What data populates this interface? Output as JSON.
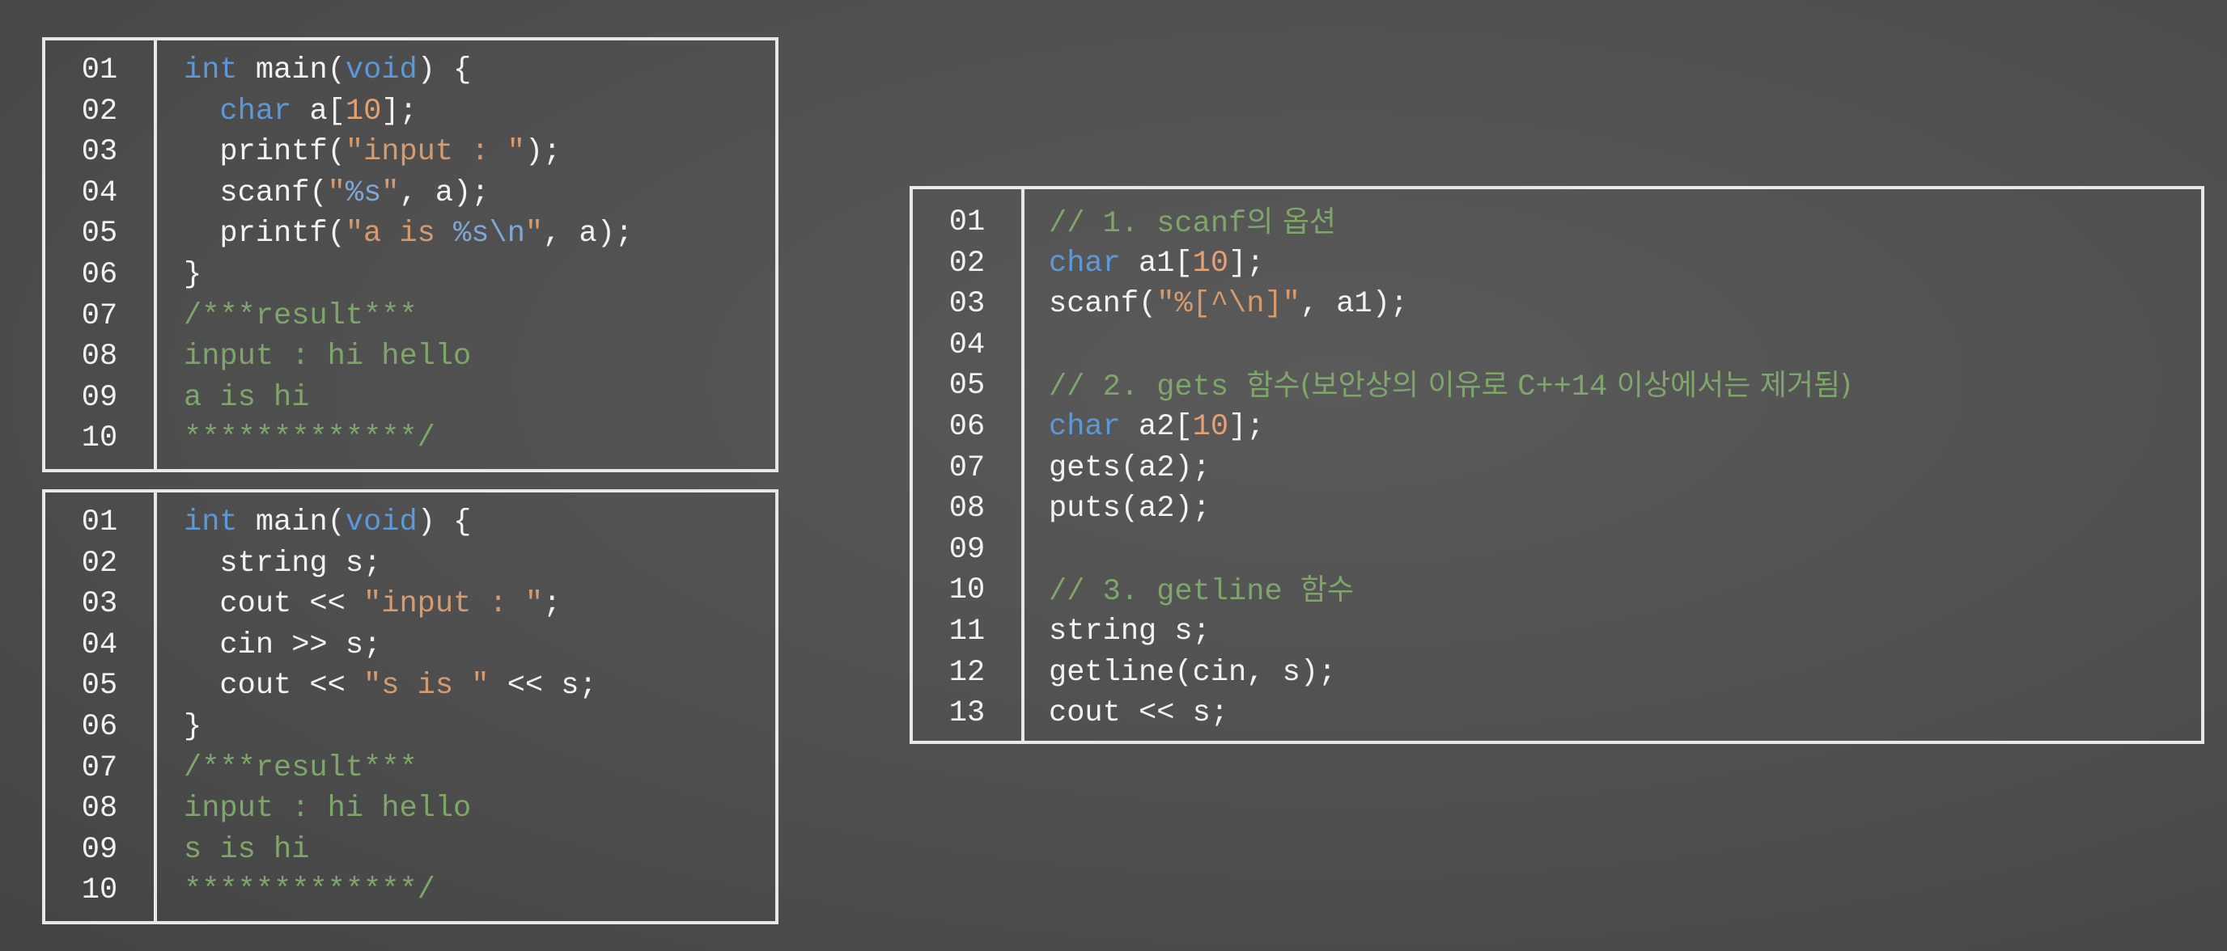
{
  "colors": {
    "background": "#4f4f4f",
    "border": "#e8e8e8",
    "keyword": "#5e97d8",
    "string": "#d59b6e",
    "comment": "#7ea66a",
    "text": "#f2f2f2"
  },
  "block1": {
    "line_numbers": [
      "01",
      "02",
      "03",
      "04",
      "05",
      "06",
      "07",
      "08",
      "09",
      "10"
    ],
    "lines": [
      [
        {
          "t": "int",
          "c": "kw"
        },
        {
          "t": " main(",
          "c": ""
        },
        {
          "t": "void",
          "c": "kw"
        },
        {
          "t": ") {",
          "c": ""
        }
      ],
      [
        {
          "t": "  ",
          "c": ""
        },
        {
          "t": "char",
          "c": "kw"
        },
        {
          "t": " a[",
          "c": ""
        },
        {
          "t": "10",
          "c": "num"
        },
        {
          "t": "];",
          "c": ""
        }
      ],
      [
        {
          "t": "  printf(",
          "c": ""
        },
        {
          "t": "\"input : \"",
          "c": "str"
        },
        {
          "t": ");",
          "c": ""
        }
      ],
      [
        {
          "t": "  scanf(",
          "c": ""
        },
        {
          "t": "\"",
          "c": "str"
        },
        {
          "t": "%s",
          "c": "esc"
        },
        {
          "t": "\"",
          "c": "str"
        },
        {
          "t": ", a);",
          "c": ""
        }
      ],
      [
        {
          "t": "  printf(",
          "c": ""
        },
        {
          "t": "\"a is ",
          "c": "str"
        },
        {
          "t": "%s",
          "c": "esc"
        },
        {
          "t": "\\n",
          "c": "esc"
        },
        {
          "t": "\"",
          "c": "str"
        },
        {
          "t": ", a);",
          "c": ""
        }
      ],
      [
        {
          "t": "}",
          "c": ""
        }
      ],
      [
        {
          "t": "/***result***",
          "c": "cm"
        }
      ],
      [
        {
          "t": "input : hi hello",
          "c": "cm"
        }
      ],
      [
        {
          "t": "a is hi",
          "c": "cm"
        }
      ],
      [
        {
          "t": "*************/",
          "c": "cm"
        }
      ]
    ]
  },
  "block2": {
    "line_numbers": [
      "01",
      "02",
      "03",
      "04",
      "05",
      "06",
      "07",
      "08",
      "09",
      "10"
    ],
    "lines": [
      [
        {
          "t": "int",
          "c": "kw"
        },
        {
          "t": " main(",
          "c": ""
        },
        {
          "t": "void",
          "c": "kw"
        },
        {
          "t": ") {",
          "c": ""
        }
      ],
      [
        {
          "t": "  string s;",
          "c": ""
        }
      ],
      [
        {
          "t": "  cout << ",
          "c": ""
        },
        {
          "t": "\"input : \"",
          "c": "str"
        },
        {
          "t": ";",
          "c": ""
        }
      ],
      [
        {
          "t": "  cin >> s;",
          "c": ""
        }
      ],
      [
        {
          "t": "  cout << ",
          "c": ""
        },
        {
          "t": "\"s is \"",
          "c": "str"
        },
        {
          "t": " << s;",
          "c": ""
        }
      ],
      [
        {
          "t": "}",
          "c": ""
        }
      ],
      [
        {
          "t": "/***result***",
          "c": "cm"
        }
      ],
      [
        {
          "t": "input : hi hello",
          "c": "cm"
        }
      ],
      [
        {
          "t": "s is hi",
          "c": "cm"
        }
      ],
      [
        {
          "t": "*************/",
          "c": "cm"
        }
      ]
    ]
  },
  "block3": {
    "line_numbers": [
      "01",
      "02",
      "03",
      "04",
      "05",
      "06",
      "07",
      "08",
      "09",
      "10",
      "11",
      "12",
      "13"
    ],
    "lines": [
      [
        {
          "t": "// 1. scanf",
          "c": "cm"
        },
        {
          "t": "의 옵션",
          "c": "cm ko"
        }
      ],
      [
        {
          "t": "char",
          "c": "kw"
        },
        {
          "t": " a1[",
          "c": ""
        },
        {
          "t": "10",
          "c": "num"
        },
        {
          "t": "];",
          "c": ""
        }
      ],
      [
        {
          "t": "scanf(",
          "c": ""
        },
        {
          "t": "\"%[^\\n]\"",
          "c": "str"
        },
        {
          "t": ", a1);",
          "c": ""
        }
      ],
      [
        {
          "t": "",
          "c": ""
        }
      ],
      [
        {
          "t": "// 2. gets ",
          "c": "cm"
        },
        {
          "t": "함수(보안상의 이유로 ",
          "c": "cm ko"
        },
        {
          "t": "C++14",
          "c": "cm"
        },
        {
          "t": " 이상에서는 제거됨)",
          "c": "cm ko"
        }
      ],
      [
        {
          "t": "char",
          "c": "kw"
        },
        {
          "t": " a2[",
          "c": ""
        },
        {
          "t": "10",
          "c": "num"
        },
        {
          "t": "];",
          "c": ""
        }
      ],
      [
        {
          "t": "gets(a2);",
          "c": ""
        }
      ],
      [
        {
          "t": "puts(a2);",
          "c": ""
        }
      ],
      [
        {
          "t": "",
          "c": ""
        }
      ],
      [
        {
          "t": "// 3. getline ",
          "c": "cm"
        },
        {
          "t": "함수",
          "c": "cm ko"
        }
      ],
      [
        {
          "t": "string s;",
          "c": ""
        }
      ],
      [
        {
          "t": "getline(cin, s);",
          "c": ""
        }
      ],
      [
        {
          "t": "cout << s;",
          "c": ""
        }
      ]
    ]
  }
}
